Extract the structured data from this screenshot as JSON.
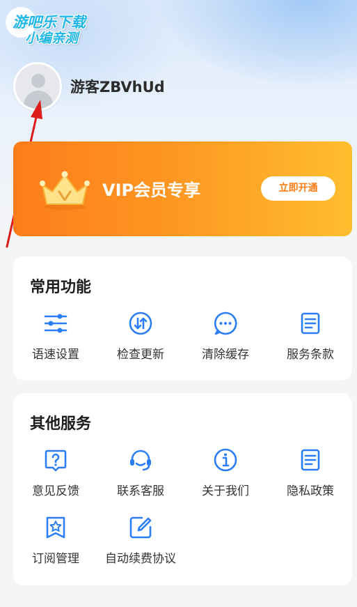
{
  "watermark": {
    "line1": "游吧乐下载",
    "line2": "小编亲测"
  },
  "profile": {
    "username": "游客ZBVhUd"
  },
  "vip": {
    "title": "VIP会员专享",
    "button": "立即开通"
  },
  "sections": {
    "common": {
      "title": "常用功能",
      "items": [
        {
          "label": "语速设置",
          "icon": "sliders-icon"
        },
        {
          "label": "检查更新",
          "icon": "update-arrows-icon"
        },
        {
          "label": "清除缓存",
          "icon": "chat-bubble-icon"
        },
        {
          "label": "服务条款",
          "icon": "document-icon"
        }
      ]
    },
    "other": {
      "title": "其他服务",
      "items": [
        {
          "label": "意见反馈",
          "icon": "question-icon"
        },
        {
          "label": "联系客服",
          "icon": "headset-icon"
        },
        {
          "label": "关于我们",
          "icon": "info-icon"
        },
        {
          "label": "隐私政策",
          "icon": "doc-lines-icon"
        },
        {
          "label": "订阅管理",
          "icon": "star-bookmark-icon"
        },
        {
          "label": "自动续费协议",
          "icon": "edit-icon"
        }
      ]
    }
  },
  "colors": {
    "accent_blue": "#2b7df6",
    "vip_orange": "#fd7c1a",
    "vip_yellow": "#ffbe2e",
    "annotation_red": "#e01b1b"
  }
}
